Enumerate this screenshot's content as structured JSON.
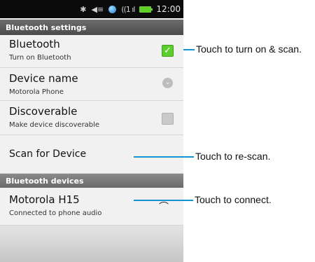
{
  "status_bar": {
    "icons": [
      "bluetooth-icon",
      "volume-icon",
      "globe-icon",
      "signal-icon",
      "battery-icon"
    ],
    "bluetooth_glyph": "✱",
    "volume_glyph": "◀≡",
    "signal_glyph": "((1 ıl",
    "time": "12:00"
  },
  "sections": {
    "settings_header": "Bluetooth settings",
    "devices_header": "Bluetooth devices"
  },
  "rows": {
    "bluetooth": {
      "title": "Bluetooth",
      "subtitle": "Turn on Bluetooth",
      "checked": true,
      "check_glyph": "✓"
    },
    "device_name": {
      "title": "Device name",
      "subtitle": "Motorola Phone",
      "chevron_glyph": "⌄"
    },
    "discoverable": {
      "title": "Discoverable",
      "subtitle": "Make device discoverable",
      "checked": false
    },
    "scan": {
      "title": "Scan for Device"
    },
    "motorola": {
      "title": "Motorola H15",
      "subtitle": "Connected to phone audio",
      "icon": "headset-icon",
      "icon_glyph": "⌒"
    }
  },
  "callouts": {
    "turn_on": "Touch to turn on & scan.",
    "rescan": "Touch to re-scan.",
    "connect": "Touch to connect."
  },
  "colors": {
    "status_bar": "#0b0b0b",
    "accent_blue": "#1592d6",
    "checkbox_green": "#5ccf2e",
    "battery_green": "#5fcf2a"
  }
}
